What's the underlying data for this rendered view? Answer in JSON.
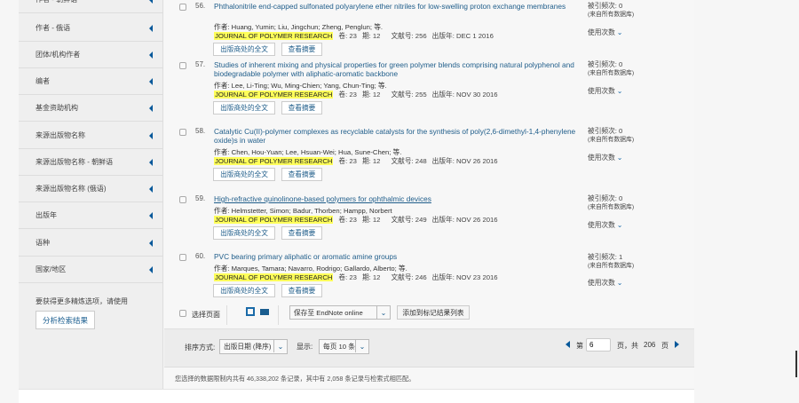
{
  "sidebar": {
    "items": [
      "作者 - 朝鲜语",
      "作者 - 俄语",
      "团体/机构作者",
      "编者",
      "基金资助机构",
      "来源出版物名称",
      "来源出版物名称 - 朝鲜语",
      "来源出版物名称 (俄语)",
      "出版年",
      "语种",
      "国家/地区"
    ],
    "note": "要获得更多精炼选项，请使用",
    "analyze_button": "分析检索结果"
  },
  "records": [
    {
      "num": "56.",
      "title": "Phthalonitrile end-capped sulfonated polyarylene ether nitriles for low-swelling proton exchange membranes",
      "authors": "作者: Huang, Yumin; Liu, Jingchun; Zheng, Penglun; 等.",
      "journal": "JOURNAL OF POLYMER RESEARCH",
      "vol": "卷: 23",
      "issue": "期: 12",
      "artno": "文献号: 256",
      "year": "出版年: DEC 1 2016",
      "cited": "被引频次: 0"
    },
    {
      "num": "57.",
      "title": "Studies of inherent mixing and physical properties for green polymer blends comprising natural polyphenol and biodegradable polymer with aliphatic-aromatic backbone",
      "authors": "作者: Lee, Li-Ting; Wu, Ming-Chien; Yang, Chun-Ting; 等.",
      "journal": "JOURNAL OF POLYMER RESEARCH",
      "vol": "卷: 23",
      "issue": "期: 12",
      "artno": "文献号: 255",
      "year": "出版年: NOV 30 2016",
      "cited": "被引频次: 0"
    },
    {
      "num": "58.",
      "title": "Catalytic Cu(II)-polymer complexes as recyclable catalysts for the synthesis of poly(2,6-dimethyl-1,4-phenylene oxide)s in water",
      "authors": "作者: Chen, Hou-Yuan; Lee, Hsuan-Wei; Hua, Sune-Chen; 等.",
      "journal": "JOURNAL OF POLYMER RESEARCH",
      "vol": "卷: 23",
      "issue": "期: 12",
      "artno": "文献号: 248",
      "year": "出版年: NOV 26 2016",
      "cited": "被引频次: 0"
    },
    {
      "num": "59.",
      "title": "High-refractive quinolinone-based polymers for ophthalmic devices",
      "authors": "作者: Helmstetter, Simon; Badur, Thorben; Hampp, Norbert",
      "journal": "JOURNAL OF POLYMER RESEARCH",
      "vol": "卷: 23",
      "issue": "期: 12",
      "artno": "文献号: 249",
      "year": "出版年: NOV 26 2016",
      "cited": "被引频次: 0"
    },
    {
      "num": "60.",
      "title": "PVC bearing primary aliphatic or aromatic amine groups",
      "authors": "作者: Marques, Tamara; Navarro, Rodrigo; Gallardo, Alberto; 等.",
      "journal": "JOURNAL OF POLYMER RESEARCH",
      "vol": "卷: 23",
      "issue": "期: 12",
      "artno": "文献号: 246",
      "year": "出版年: NOV 23 2016",
      "cited": "被引频次: 1"
    }
  ],
  "record_labels": {
    "fulltext": "出版商处的全文",
    "abstract": "查看摘要",
    "cited_source": "(来自所有数据库)",
    "usage": "使用次数"
  },
  "actions": {
    "select_page": "选择页面",
    "save_to": "保存至 EndNote online",
    "add_marked": "添加到标记结果列表"
  },
  "pager": {
    "sort_label": "排序方式:",
    "sort_value": "出版日期 (降序)",
    "show_label": "显示:",
    "show_value": "每页 10 条",
    "page_prefix": "第",
    "page_value": "6",
    "page_suffix": "页，共",
    "total_pages": "206",
    "page_unit": "页"
  },
  "footer": "您选择的数据限制内共有 46,338,202 条记录，其中有 2,058 条记录与检索式相匹配。",
  "colors": {
    "link": "#1f5d8a",
    "highlight": "#ffff5a",
    "accent": "#05589a"
  }
}
